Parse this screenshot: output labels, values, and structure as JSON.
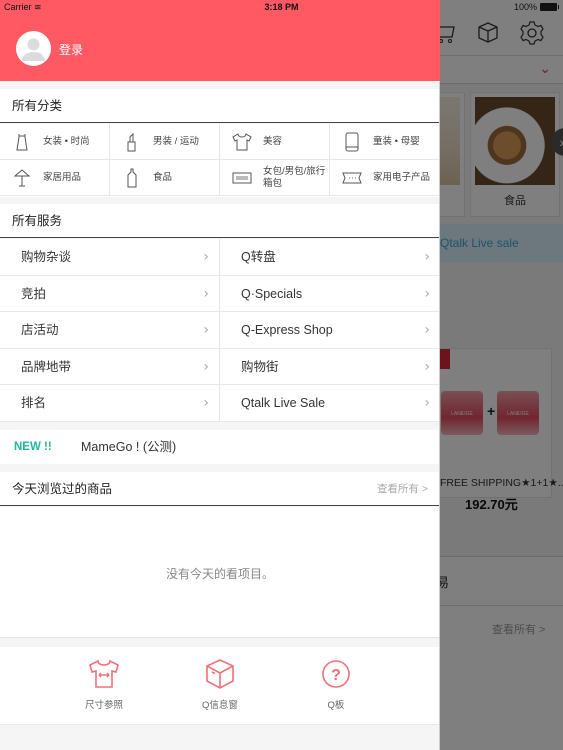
{
  "status_bar": {
    "carrier": "Carrier",
    "time": "3:18 PM",
    "battery": "100%"
  },
  "colors": {
    "header_red": "#ff5a63",
    "new_green": "#20b89a",
    "icon_pink": "#f0707a"
  },
  "drawer": {
    "login_label": "登录",
    "categories": {
      "title": "所有分类",
      "items": [
        {
          "label": "女装 • 时尚",
          "icon": "dress-icon"
        },
        {
          "label": "男装 / 运动",
          "icon": "lipstick-icon"
        },
        {
          "label": "美容",
          "icon": "tshirt-icon"
        },
        {
          "label": "童装 • 母婴",
          "icon": "phone-icon"
        },
        {
          "label": "家居用品",
          "icon": "lamp-icon"
        },
        {
          "label": "食品",
          "icon": "bottle-icon"
        },
        {
          "label": "女包/男包/旅行箱包",
          "icon": "barcode-icon"
        },
        {
          "label": "家用电子产品",
          "icon": "ticket-icon"
        }
      ]
    },
    "services": {
      "title": "所有服务",
      "items": [
        {
          "label": "购物杂谈"
        },
        {
          "label": "Q转盘"
        },
        {
          "label": "竞拍"
        },
        {
          "label": "Q·Specials"
        },
        {
          "label": "店活动"
        },
        {
          "label": "Q-Express Shop"
        },
        {
          "label": "品牌地带"
        },
        {
          "label": "购物街"
        },
        {
          "label": "排名"
        },
        {
          "label": "Qtalk Live Sale"
        }
      ]
    },
    "new_row": {
      "badge": "NEW !!",
      "text": "MameGo ! (公测)"
    },
    "recent": {
      "title": "今天浏览过的商品",
      "see_all": "查看所有 >",
      "empty_message": "没有今天的看项目。"
    },
    "bottom_bar": [
      {
        "label": "尺寸参照",
        "icon": "size-shirt-icon"
      },
      {
        "label": "Q信息窗",
        "icon": "box-icon"
      },
      {
        "label": "Q板",
        "icon": "help-icon"
      }
    ]
  },
  "background": {
    "category_card_label": "食品",
    "live_sale_label": "Qtalk Live sale",
    "product_title": "FREE SHIPPING★1+1★...",
    "product_price": "192.70元",
    "section_title_fragment": "易",
    "see_all": "查看所有 >"
  }
}
